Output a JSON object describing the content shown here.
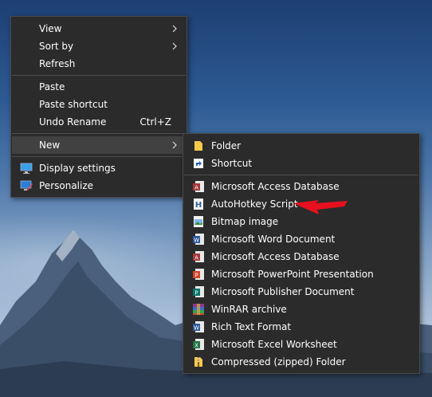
{
  "colors": {
    "menu_bg": "#2b2b2b",
    "menu_border": "#4a4a4a",
    "highlight": "#414141",
    "annotation_arrow": "#e8101f"
  },
  "context_menu": {
    "items": [
      {
        "label": "View",
        "submenu": true
      },
      {
        "label": "Sort by",
        "submenu": true
      },
      {
        "label": "Refresh"
      },
      {
        "label": "Paste"
      },
      {
        "label": "Paste shortcut"
      },
      {
        "label": "Undo Rename",
        "shortcut": "Ctrl+Z"
      },
      {
        "label": "New",
        "submenu": true,
        "highlighted": true
      },
      {
        "label": "Display settings",
        "icon": "display-settings-icon"
      },
      {
        "label": "Personalize",
        "icon": "personalize-icon"
      }
    ]
  },
  "new_submenu": {
    "items": [
      {
        "label": "Folder",
        "icon": "folder-icon"
      },
      {
        "label": "Shortcut",
        "icon": "shortcut-icon"
      },
      {
        "label": "Microsoft Access Database",
        "icon": "access-icon"
      },
      {
        "label": "AutoHotkey Script",
        "icon": "autohotkey-icon"
      },
      {
        "label": "Bitmap image",
        "icon": "bitmap-icon"
      },
      {
        "label": "Microsoft Word Document",
        "icon": "word-icon"
      },
      {
        "label": "Microsoft Access Database",
        "icon": "access-icon"
      },
      {
        "label": "Microsoft PowerPoint Presentation",
        "icon": "powerpoint-icon"
      },
      {
        "label": "Microsoft Publisher Document",
        "icon": "publisher-icon"
      },
      {
        "label": "WinRAR archive",
        "icon": "winrar-icon"
      },
      {
        "label": "Rich Text Format",
        "icon": "rtf-icon"
      },
      {
        "label": "Microsoft Excel Worksheet",
        "icon": "excel-icon"
      },
      {
        "label": "Compressed (zipped) Folder",
        "icon": "zip-folder-icon"
      }
    ]
  }
}
